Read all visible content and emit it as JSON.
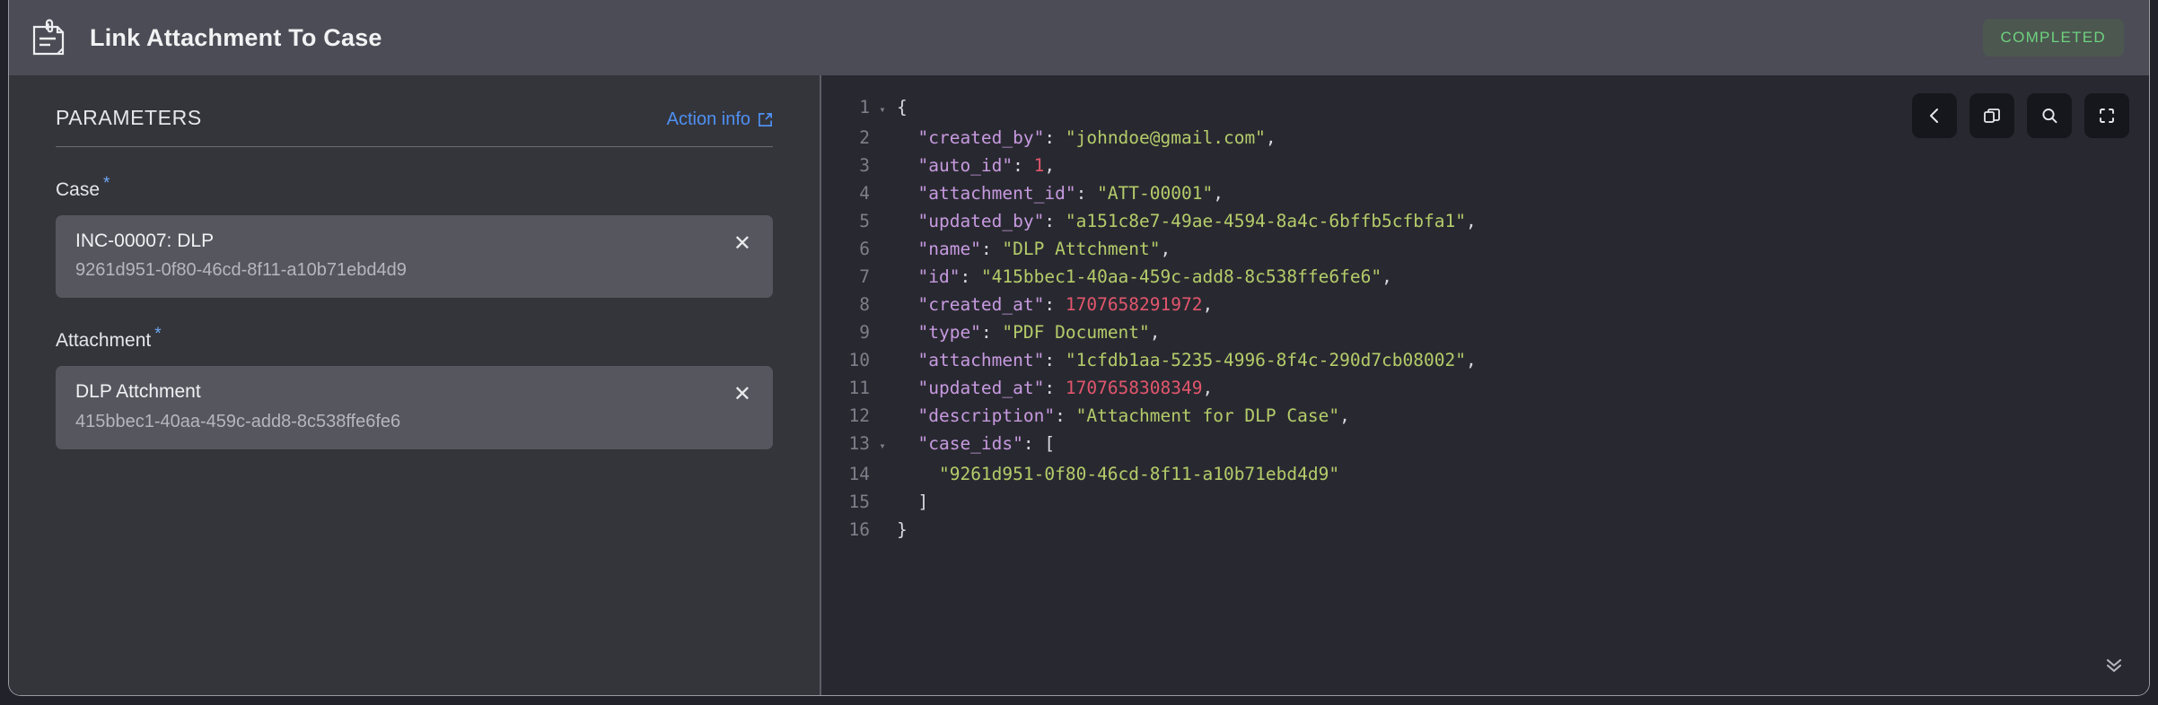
{
  "header": {
    "icon": "document-attachment-icon",
    "title": "Link Attachment To Case",
    "status": "COMPLETED",
    "status_color": "#6ed27e"
  },
  "parameters": {
    "section_title": "PARAMETERS",
    "action_info_label": "Action info",
    "action_info_icon": "external-link-icon",
    "required_marker": "*",
    "fields": [
      {
        "label": "Case",
        "required": true,
        "primary": "INC-00007: DLP",
        "secondary": "9261d951-0f80-46cd-8f11-a10b71ebd4d9",
        "clear_label": "✕"
      },
      {
        "label": "Attachment",
        "required": true,
        "primary": "DLP Attchment",
        "secondary": "415bbec1-40aa-459c-add8-8c538ffe6fe6",
        "clear_label": "✕"
      }
    ]
  },
  "code_panel": {
    "toolbar": [
      {
        "name": "back-button",
        "icon": "chevron-left-icon"
      },
      {
        "name": "copy-button",
        "icon": "copy-icon"
      },
      {
        "name": "search-button",
        "icon": "search-icon"
      },
      {
        "name": "fullscreen-button",
        "icon": "expand-corners-icon"
      }
    ],
    "scroll_down_icon": "double-chevron-down-icon",
    "lines": [
      {
        "n": "1",
        "fold": "▾",
        "indent": 0,
        "tokens": [
          {
            "t": "punc",
            "v": "{"
          }
        ]
      },
      {
        "n": "2",
        "fold": "",
        "indent": 1,
        "tokens": [
          {
            "t": "key",
            "v": "\"created_by\""
          },
          {
            "t": "punc",
            "v": ": "
          },
          {
            "t": "str",
            "v": "\"johndoe@gmail.com\""
          },
          {
            "t": "punc",
            "v": ","
          }
        ]
      },
      {
        "n": "3",
        "fold": "",
        "indent": 1,
        "tokens": [
          {
            "t": "key",
            "v": "\"auto_id\""
          },
          {
            "t": "punc",
            "v": ": "
          },
          {
            "t": "num",
            "v": "1"
          },
          {
            "t": "punc",
            "v": ","
          }
        ]
      },
      {
        "n": "4",
        "fold": "",
        "indent": 1,
        "tokens": [
          {
            "t": "key",
            "v": "\"attachment_id\""
          },
          {
            "t": "punc",
            "v": ": "
          },
          {
            "t": "str",
            "v": "\"ATT-00001\""
          },
          {
            "t": "punc",
            "v": ","
          }
        ]
      },
      {
        "n": "5",
        "fold": "",
        "indent": 1,
        "tokens": [
          {
            "t": "key",
            "v": "\"updated_by\""
          },
          {
            "t": "punc",
            "v": ": "
          },
          {
            "t": "str",
            "v": "\"a151c8e7-49ae-4594-8a4c-6bffb5cfbfa1\""
          },
          {
            "t": "punc",
            "v": ","
          }
        ]
      },
      {
        "n": "6",
        "fold": "",
        "indent": 1,
        "tokens": [
          {
            "t": "key",
            "v": "\"name\""
          },
          {
            "t": "punc",
            "v": ": "
          },
          {
            "t": "str",
            "v": "\"DLP Attchment\""
          },
          {
            "t": "punc",
            "v": ","
          }
        ]
      },
      {
        "n": "7",
        "fold": "",
        "indent": 1,
        "tokens": [
          {
            "t": "key",
            "v": "\"id\""
          },
          {
            "t": "punc",
            "v": ": "
          },
          {
            "t": "str",
            "v": "\"415bbec1-40aa-459c-add8-8c538ffe6fe6\""
          },
          {
            "t": "punc",
            "v": ","
          }
        ]
      },
      {
        "n": "8",
        "fold": "",
        "indent": 1,
        "tokens": [
          {
            "t": "key",
            "v": "\"created_at\""
          },
          {
            "t": "punc",
            "v": ": "
          },
          {
            "t": "num",
            "v": "1707658291972"
          },
          {
            "t": "punc",
            "v": ","
          }
        ]
      },
      {
        "n": "9",
        "fold": "",
        "indent": 1,
        "tokens": [
          {
            "t": "key",
            "v": "\"type\""
          },
          {
            "t": "punc",
            "v": ": "
          },
          {
            "t": "str",
            "v": "\"PDF Document\""
          },
          {
            "t": "punc",
            "v": ","
          }
        ]
      },
      {
        "n": "10",
        "fold": "",
        "indent": 1,
        "tokens": [
          {
            "t": "key",
            "v": "\"attachment\""
          },
          {
            "t": "punc",
            "v": ": "
          },
          {
            "t": "str",
            "v": "\"1cfdb1aa-5235-4996-8f4c-290d7cb08002\""
          },
          {
            "t": "punc",
            "v": ","
          }
        ]
      },
      {
        "n": "11",
        "fold": "",
        "indent": 1,
        "tokens": [
          {
            "t": "key",
            "v": "\"updated_at\""
          },
          {
            "t": "punc",
            "v": ": "
          },
          {
            "t": "num",
            "v": "1707658308349"
          },
          {
            "t": "punc",
            "v": ","
          }
        ]
      },
      {
        "n": "12",
        "fold": "",
        "indent": 1,
        "tokens": [
          {
            "t": "key",
            "v": "\"description\""
          },
          {
            "t": "punc",
            "v": ": "
          },
          {
            "t": "str",
            "v": "\"Attachment for DLP Case\""
          },
          {
            "t": "punc",
            "v": ","
          }
        ]
      },
      {
        "n": "13",
        "fold": "▾",
        "indent": 1,
        "tokens": [
          {
            "t": "key",
            "v": "\"case_ids\""
          },
          {
            "t": "punc",
            "v": ": ["
          }
        ]
      },
      {
        "n": "14",
        "fold": "",
        "indent": 2,
        "tokens": [
          {
            "t": "str",
            "v": "\"9261d951-0f80-46cd-8f11-a10b71ebd4d9\""
          }
        ]
      },
      {
        "n": "15",
        "fold": "",
        "indent": 1,
        "tokens": [
          {
            "t": "punc",
            "v": "]"
          }
        ]
      },
      {
        "n": "16",
        "fold": "",
        "indent": 0,
        "tokens": [
          {
            "t": "punc",
            "v": "}"
          }
        ]
      }
    ]
  }
}
